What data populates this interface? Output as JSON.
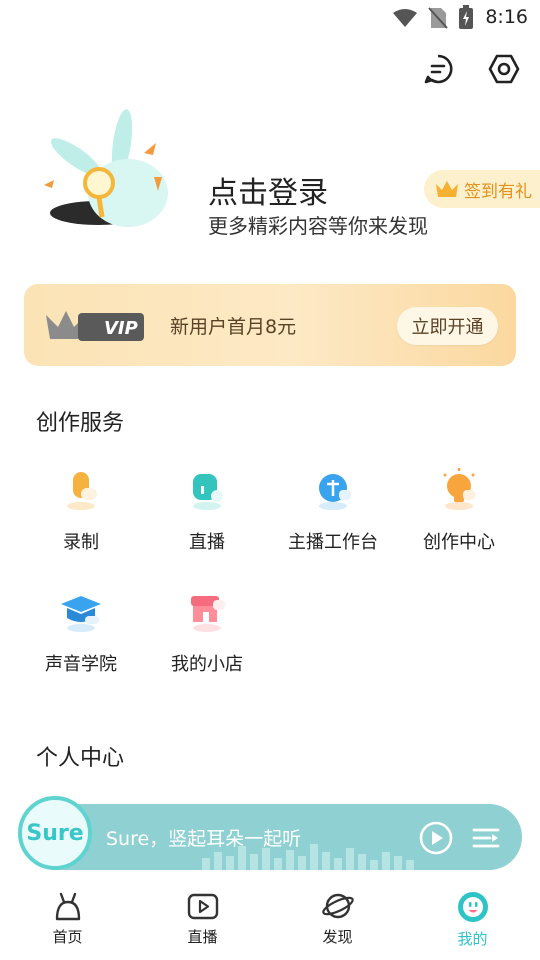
{
  "status": {
    "time": "8:16"
  },
  "header": {
    "message_icon": "chat-bubble-icon",
    "settings_icon": "settings-hexagon-icon"
  },
  "profile": {
    "title": "点击登录",
    "subtitle": "更多精彩内容等你来发现",
    "checkin_label": "签到有礼"
  },
  "vip": {
    "badge_text": "VIP",
    "promo": "新用户首月8元",
    "button": "立即开通"
  },
  "creation": {
    "title": "创作服务",
    "items": [
      {
        "label": "录制",
        "icon": "microphone-icon"
      },
      {
        "label": "直播",
        "icon": "live-broadcast-icon"
      },
      {
        "label": "主播工作台",
        "icon": "anchor-workbench-icon"
      },
      {
        "label": "创作中心",
        "icon": "lightbulb-icon"
      },
      {
        "label": "声音学院",
        "icon": "graduation-cap-icon"
      },
      {
        "label": "我的小店",
        "icon": "shop-icon"
      }
    ]
  },
  "personal": {
    "title": "个人中心"
  },
  "player": {
    "logo_text": "Sure",
    "text": "Sure，竖起耳朵一起听"
  },
  "nav": {
    "items": [
      {
        "label": "首页",
        "active": false
      },
      {
        "label": "直播",
        "active": false
      },
      {
        "label": "发现",
        "active": false
      },
      {
        "label": "我的",
        "active": true
      }
    ]
  },
  "colors": {
    "accent": "#2ec4c7",
    "vip_text": "#5b4226",
    "checkin": "#e3911b"
  }
}
